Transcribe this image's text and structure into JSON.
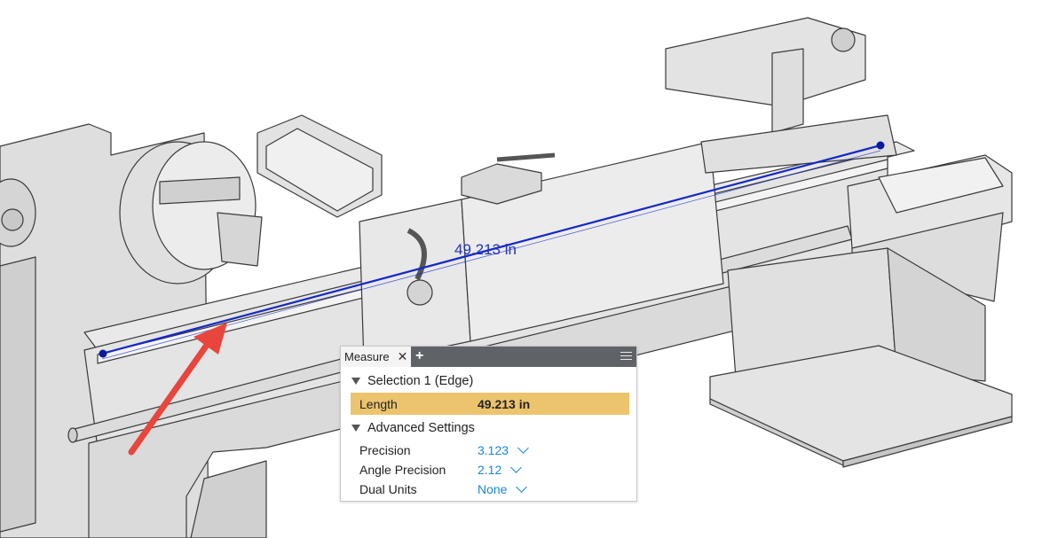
{
  "viewport": {
    "dimension_label": "49.213 in",
    "colors": {
      "measure_line": "#1428c8",
      "annotation_arrow": "#e8453c",
      "model_fill": "#e6e6e6",
      "model_edge": "#3a3a3a"
    }
  },
  "measure_panel": {
    "tab_title": "Measure",
    "close_icon": "close-icon",
    "add_icon": "plus-icon",
    "menu_icon": "hamburger-menu-icon",
    "selection": {
      "title": "Selection 1 (Edge)",
      "length_label": "Length",
      "length_value": "49.213 in",
      "highlight_color": "#ecc46e"
    },
    "advanced": {
      "title": "Advanced Settings",
      "settings": [
        {
          "label": "Precision",
          "value": "3.123"
        },
        {
          "label": "Angle Precision",
          "value": "2.12"
        },
        {
          "label": "Dual Units",
          "value": "None"
        }
      ]
    }
  }
}
